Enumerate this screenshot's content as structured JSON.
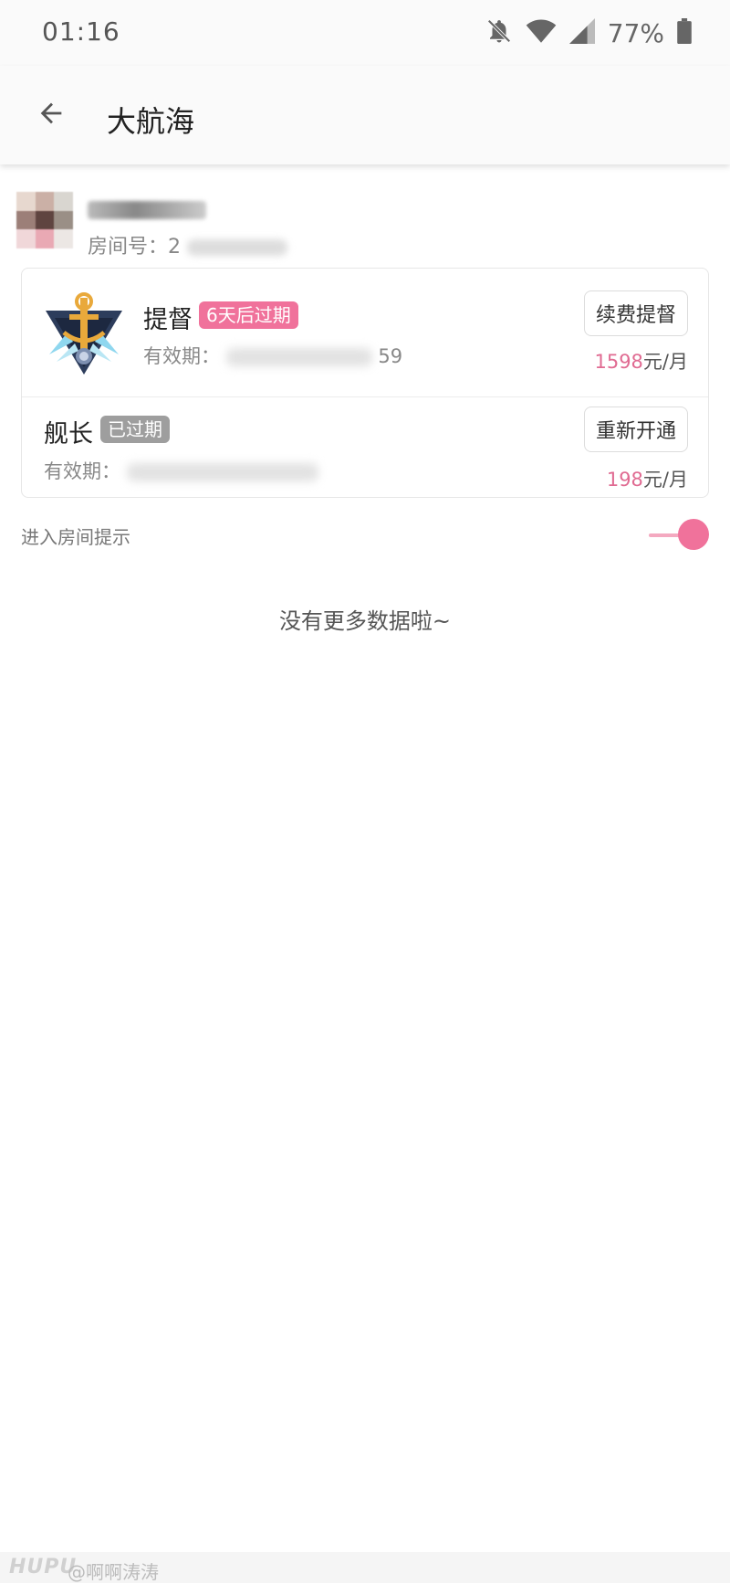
{
  "status_bar": {
    "time": "01:16",
    "battery": "77%",
    "icons": [
      "bell-off-icon",
      "wifi-icon",
      "signal-icon",
      "battery-icon"
    ]
  },
  "app_bar": {
    "title": "大航海",
    "back_icon": "arrow-left-icon"
  },
  "profile": {
    "room_label": "房间号：",
    "room_prefix": "2"
  },
  "subscriptions": [
    {
      "name": "提督",
      "badge_icon": "admiral-badge-icon",
      "status": "6天后过期",
      "status_color": "#f0729b",
      "validity_label": "有效期：",
      "validity_tail": "59",
      "action": "续费提督",
      "price_number": "1598",
      "price_unit": "元/月"
    },
    {
      "name": "舰长",
      "status": "已过期",
      "status_color": "#9e9e9e",
      "validity_label": "有效期：",
      "action": "重新开通",
      "price_number": "198",
      "price_unit": "元/月"
    }
  ],
  "settings": {
    "enter_room_hint_label": "进入房间提示",
    "enter_room_hint_on": true
  },
  "footer": {
    "no_more": "没有更多数据啦~"
  },
  "watermark": {
    "brand": "HUPU",
    "user": "@啊啊涛涛"
  },
  "colors": {
    "accent": "#f0729b",
    "price": "#e06b92"
  }
}
